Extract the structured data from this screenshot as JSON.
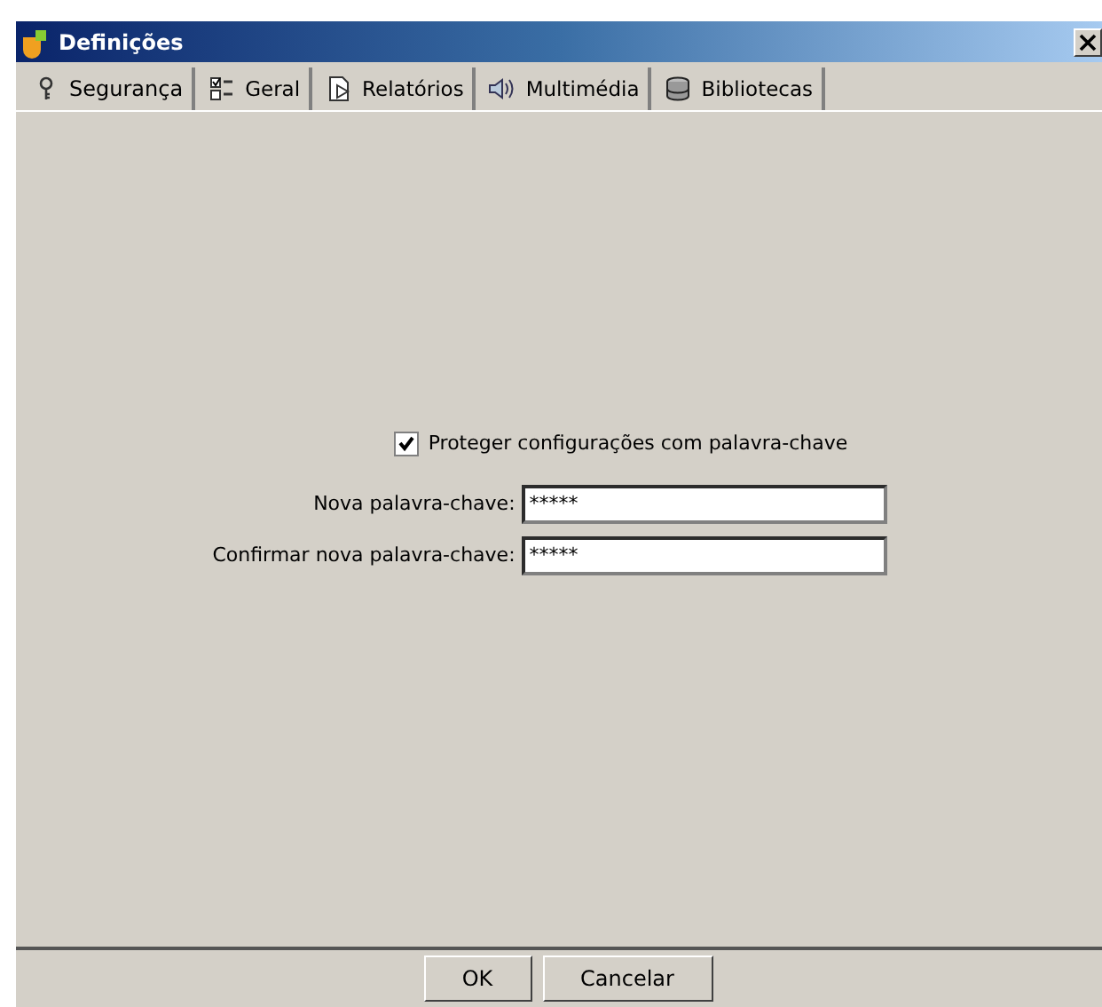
{
  "window": {
    "title": "Definições"
  },
  "tabs": [
    {
      "label": "Segurança",
      "kind": "key",
      "selected": true
    },
    {
      "label": "Geral",
      "kind": "list",
      "selected": false
    },
    {
      "label": "Relatórios",
      "kind": "report",
      "selected": false
    },
    {
      "label": "Multimédia",
      "kind": "speaker",
      "selected": false
    },
    {
      "label": "Bibliotecas",
      "kind": "database",
      "selected": false
    }
  ],
  "protect_checkbox": {
    "label": "Proteger configurações com palavra-chave",
    "checked": true
  },
  "fields": [
    {
      "label": "Nova palavra-chave:",
      "value": "*****"
    },
    {
      "label": "Confirmar nova palavra-chave:",
      "value": "*****"
    }
  ],
  "buttons": [
    "OK",
    "Cancelar"
  ]
}
